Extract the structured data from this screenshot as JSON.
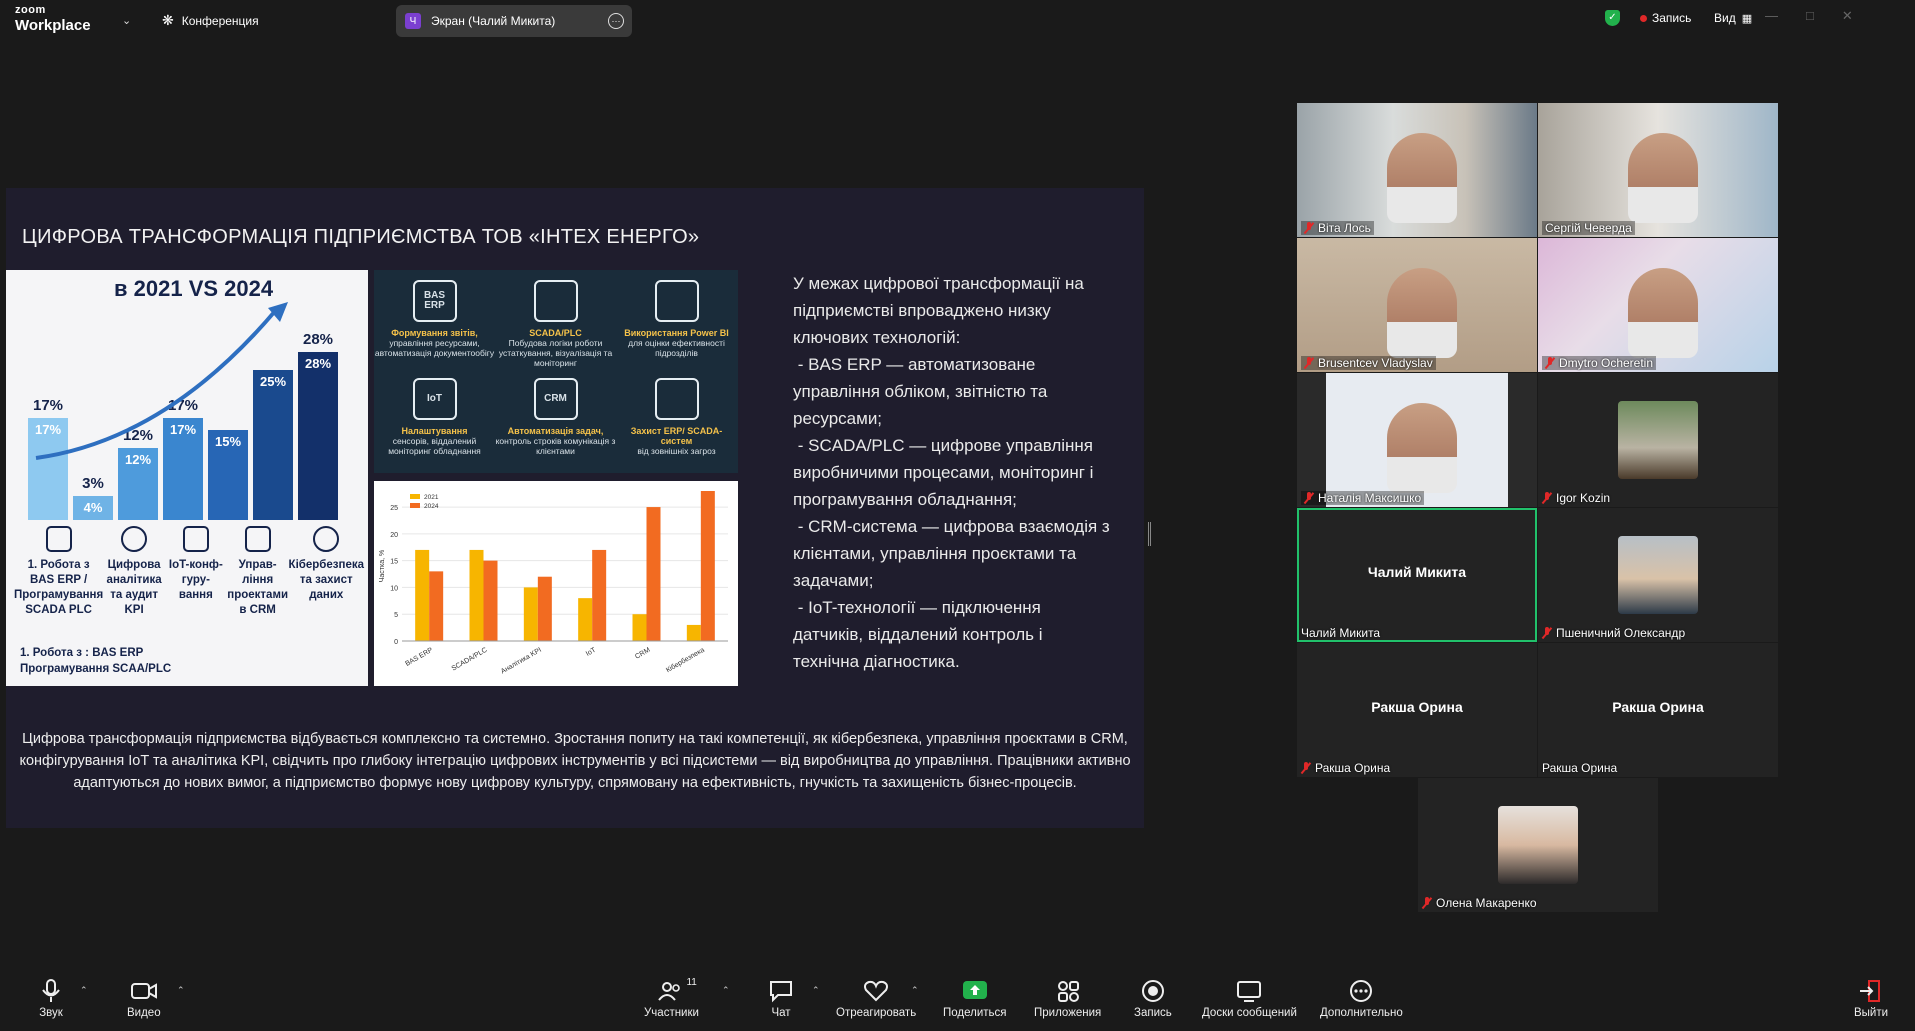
{
  "app": {
    "brand_top": "zoom",
    "brand_bottom": "Workplace",
    "conference_label": "Конференция"
  },
  "share_pill": {
    "avatar_letter": "Ч",
    "label": "Экран (Чалий Микита)"
  },
  "top_right": {
    "record_label": "Запись",
    "view_label": "Вид"
  },
  "slide": {
    "title": "ЦИФРОВА ТРАНСФОРМАЦІЯ ПІДПРИЄМСТВА ТОВ «ІНТЕХ ЕНЕРГО»",
    "panel_a": {
      "title": "в 2021 VS 2024",
      "bars": [
        {
          "top_label": "17%",
          "inner_label": "17%",
          "value": 17
        },
        {
          "top_label": "3%",
          "inner_label": "4%",
          "value": 4
        },
        {
          "top_label": "12%",
          "inner_label": "12%",
          "value": 12
        },
        {
          "top_label": "17%",
          "inner_label": "17%",
          "value": 17
        },
        {
          "top_label": "",
          "inner_label": "15%",
          "value": 15
        },
        {
          "top_label": "",
          "inner_label": "25%",
          "value": 25
        },
        {
          "top_label": "28%",
          "inner_label": "28%",
          "value": 28
        }
      ],
      "items": [
        {
          "label": "1. Робота з BAS ERP / Програмування SCADA PLC"
        },
        {
          "label": "Цифрова аналітика та аудит KPI"
        },
        {
          "label": "IoT-конф-гуру-вання"
        },
        {
          "label": "Управ-ління проектами в CRM"
        },
        {
          "label": "Кібербезпека та захист даних"
        }
      ],
      "note": "1. Робота з : BAS ERP\nПрограмування SCAA/PLC"
    },
    "panel_b": [
      {
        "icon_text": "BAS ERP",
        "title": "Формування звітів,",
        "desc": "управління ресурсами, автоматизація документообігу"
      },
      {
        "icon_text": "",
        "title": "SCADA/PLC",
        "desc": "Побудова логіки роботи устаткування, візуалізація та моніторинг"
      },
      {
        "icon_text": "",
        "title": "Використання Power BI",
        "desc": "для оцінки ефективності підрозділів"
      },
      {
        "icon_text": "IoT",
        "title": "Налаштування",
        "desc": "сенсорів, віддалений моніторинг обладнання"
      },
      {
        "icon_text": "CRM",
        "title": "Автоматизація задач,",
        "desc": "контроль строків комунікація з клієнтами"
      },
      {
        "icon_text": "",
        "title": "Захист ERP/ SCADA-систем",
        "desc": "від зовнішніх загроз"
      }
    ],
    "bullets": [
      "У межах цифрової трансформації на підприємстві впроваджено низку ключових технологій:",
      " - BAS ERP — автоматизоване управління обліком, звітністю та ресурсами;",
      " - SCADA/PLC — цифрове управління виробничими процесами, моніторинг і програмування обладнання;",
      " - CRM-система — цифрова взаємодія з клієнтами, управління проєктами та задачами;",
      " - IoT-технології — підключення датчиків, віддалений контроль і технічна діагностика."
    ],
    "footer": "Цифрова трансформація підприємства відбувається комплексно та системно. Зростання попиту на такі компетенції, як кібербезпека, управління проєктами в CRM, конфігурування IoT та аналітика KPI, свідчить про глибоку інтеграцію цифрових інструментів у всі підсистеми — від виробництва до управління. Працівники активно адаптуються до нових вимог, а підприємство формує нову цифрову культуру, спрямовану на ефективність, гнучкість та захищеність бізнес-процесів."
  },
  "chart_data": {
    "type": "bar",
    "categories": [
      "BAS ERP",
      "SCADA/PLC",
      "Аналітика KPI",
      "IoT",
      "CRM",
      "Кібербезпека"
    ],
    "series": [
      {
        "name": "2021",
        "values": [
          17,
          17,
          10,
          8,
          5,
          3
        ]
      },
      {
        "name": "2024",
        "values": [
          13,
          15,
          12,
          17,
          25,
          28
        ]
      }
    ],
    "title": "",
    "xlabel": "",
    "ylabel": "Частка, %",
    "ylim": [
      0,
      28
    ],
    "yticks": [
      "0",
      "5",
      "10",
      "15",
      "20",
      "25"
    ],
    "legend": "top-left",
    "grid": true,
    "colors": {
      "2021": "#f7b500",
      "2024": "#f26b21"
    }
  },
  "participants": [
    {
      "name": "Віта Лось",
      "muted": true,
      "video": true
    },
    {
      "name": "Сергій Чеверда",
      "muted": false,
      "video": true
    },
    {
      "name": "Brusentcev Vladyslav",
      "muted": true,
      "video": true
    },
    {
      "name": "Dmytro Ocheretin",
      "muted": true,
      "video": true
    },
    {
      "name": "Наталія Максишко",
      "muted": true,
      "video": true
    },
    {
      "name": "Igor Kozin",
      "muted": true,
      "video": false
    },
    {
      "name": "Чалий Микита",
      "muted": false,
      "video": false,
      "center": "Чалий Микита"
    },
    {
      "name": "Пшеничний Олександр",
      "muted": true,
      "video": false
    },
    {
      "name": "Ракша Орина",
      "muted": true,
      "video": false,
      "center": "Ракша Орина"
    },
    {
      "name": "Ракша Орина",
      "muted": false,
      "video": false,
      "center": "Ракша Орина"
    },
    {
      "name": "Олена Макаренко",
      "muted": true,
      "video": false
    }
  ],
  "toolbar": {
    "sound": "Звук",
    "video": "Видео",
    "participants": "Участники",
    "participants_count": "11",
    "chat": "Чат",
    "react": "Отреагировать",
    "share": "Поделиться",
    "apps": "Приложения",
    "record": "Запись",
    "boards": "Доски сообщений",
    "more": "Дополнительно",
    "leave": "Выйти"
  },
  "colors": {
    "accent_green": "#21c16b",
    "share_green": "#22b14c",
    "mute_red": "#e02828",
    "bar_2021": "#f7b500",
    "bar_2024": "#f26b21"
  }
}
